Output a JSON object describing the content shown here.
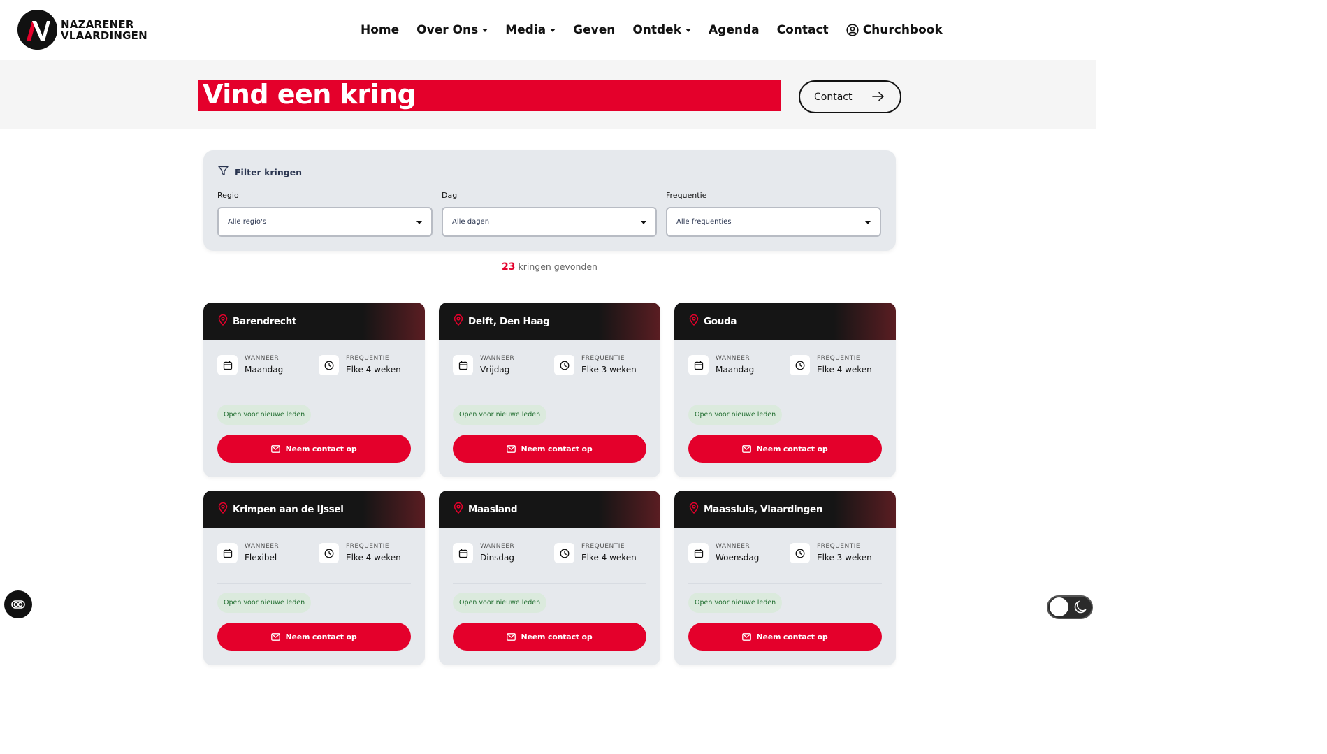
{
  "brand": {
    "line1": "NAZARENER",
    "line2": "VLAARDINGEN",
    "logo_letter": "N",
    "colors": {
      "red": "#e4002b",
      "dark": "#111111"
    }
  },
  "nav": {
    "items": [
      {
        "label": "Home",
        "dropdown": false
      },
      {
        "label": "Over Ons",
        "dropdown": true
      },
      {
        "label": "Media",
        "dropdown": true
      },
      {
        "label": "Geven",
        "dropdown": false
      },
      {
        "label": "Ontdek",
        "dropdown": true
      },
      {
        "label": "Agenda",
        "dropdown": false
      },
      {
        "label": "Contact",
        "dropdown": false
      },
      {
        "label": "Churchbook",
        "dropdown": false,
        "icon": "user-circle-icon"
      }
    ]
  },
  "hero": {
    "title": "Vind een kring",
    "contact_button": "Contact",
    "contact_icon": "arrow-right-icon"
  },
  "filter": {
    "heading": "Filter kringen",
    "heading_icon": "funnel-icon",
    "fields": [
      {
        "label": "Regio",
        "value": "Alle regio's"
      },
      {
        "label": "Dag",
        "value": "Alle dagen"
      },
      {
        "label": "Frequentie",
        "value": "Alle frequenties"
      }
    ]
  },
  "results": {
    "count": "23",
    "text": "kringen gevonden"
  },
  "cards": [
    {
      "title": "Barendrecht",
      "when_label": "WANNEER",
      "when": "Maandag",
      "freq_label": "FREQUENTIE",
      "freq": "Elke 4 weken",
      "badge": "Open voor nieuwe leden",
      "cta": "Neem contact op"
    },
    {
      "title": "Delft, Den Haag",
      "when_label": "WANNEER",
      "when": "Vrijdag",
      "freq_label": "FREQUENTIE",
      "freq": "Elke 3 weken",
      "badge": "Open voor nieuwe leden",
      "cta": "Neem contact op"
    },
    {
      "title": "Gouda",
      "when_label": "WANNEER",
      "when": "Maandag",
      "freq_label": "FREQUENTIE",
      "freq": "Elke 4 weken",
      "badge": "Open voor nieuwe leden",
      "cta": "Neem contact op"
    },
    {
      "title": "Krimpen aan de IJssel",
      "when_label": "WANNEER",
      "when": "Flexibel",
      "freq_label": "FREQUENTIE",
      "freq": "Elke 4 weken",
      "badge": "Open voor nieuwe leden",
      "cta": "Neem contact op"
    },
    {
      "title": "Maasland",
      "when_label": "WANNEER",
      "when": "Dinsdag",
      "freq_label": "FREQUENTIE",
      "freq": "Elke 4 weken",
      "badge": "Open voor nieuwe leden",
      "cta": "Neem contact op"
    },
    {
      "title": "Maassluis, Vlaardingen",
      "when_label": "WANNEER",
      "when": "Woensdag",
      "freq_label": "FREQUENTIE",
      "freq": "Elke 3 weken",
      "badge": "Open voor nieuwe leden",
      "cta": "Neem contact op"
    }
  ],
  "widgets": {
    "accessibility_icon": "accessibility-icon",
    "theme_toggle_icon": "moon-icon"
  }
}
